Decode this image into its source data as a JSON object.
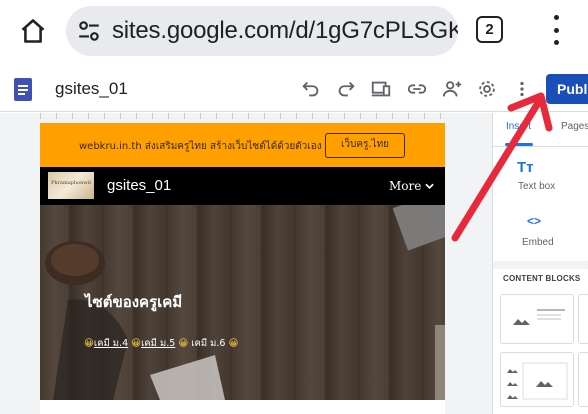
{
  "browser": {
    "url": "sites.google.com/d/1gG7cPLSGK",
    "tab_count": "2",
    "icons": [
      "home-icon",
      "tune-icon",
      "tabs-icon",
      "more-vert-icon"
    ]
  },
  "toolbar": {
    "site_name": "gsites_01",
    "publish_label": "Publish",
    "icons": [
      "undo-icon",
      "redo-icon",
      "preview-icon",
      "link-icon",
      "share-icon",
      "settings-icon",
      "more-vert-icon"
    ],
    "accent": "#1a4fb8"
  },
  "preview": {
    "announcement_text": "webkru.in.th ส่งเสริมครูไทย สร้างเว็บไซต์ได้ด้วยตัวเอง",
    "announcement_button": "เว็บครู.ไทย",
    "announcement_color": "#ff9f00",
    "logo_text": "Phramaphonwit",
    "nav_title": "gsites_01",
    "nav_more": "More",
    "hero_title": "ไซต์ของครูเคมี",
    "hero_links": {
      "emoji": "😀",
      "link1": "เคมี ม.4",
      "link2": "เคมี ม.5",
      "link3": "เคมี ม.6"
    }
  },
  "panel": {
    "tab_insert": "Insert",
    "tab_pages": "Pages",
    "textbox_label": "Text box",
    "embed_label": "Embed",
    "content_blocks_title": "CONTENT BLOCKS"
  },
  "annotation": {
    "arrow_color": "#e8293b"
  }
}
